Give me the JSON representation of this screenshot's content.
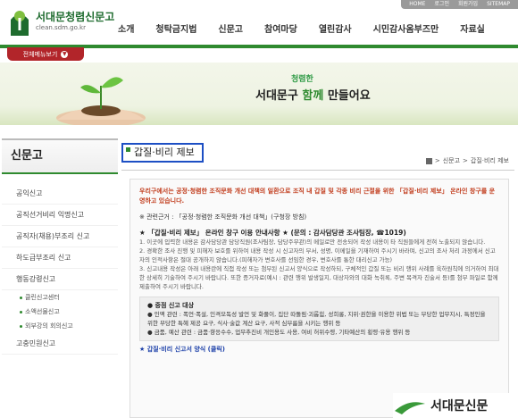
{
  "util_links": [
    "HOME",
    "로그인",
    "회원가입",
    "SITEMAP"
  ],
  "logo": {
    "title": "서대문청렴신문고",
    "subtitle": "clean.sdm.go.kr"
  },
  "gnb": [
    "소개",
    "청탁금지법",
    "신문고",
    "참여마당",
    "열린감사",
    "시민감사옴부즈만",
    "자료실"
  ],
  "all_menu_label": "전체메뉴보기",
  "banner": {
    "small": "청렴한",
    "slogan_prefix": "서대문구 ",
    "slogan_highlight": "함께",
    "slogan_suffix": " 만들어요"
  },
  "sidebar": {
    "title": "신문고",
    "items": [
      {
        "label": "공익신고"
      },
      {
        "label": "공직선거비리 익명신고"
      },
      {
        "label": "공직자(채용)부조리 신고"
      },
      {
        "label": "하도급부조리 신고"
      },
      {
        "label": "행동강령신고"
      }
    ],
    "subitems": [
      {
        "label": "클린신고센터"
      },
      {
        "label": "소액선물신고"
      },
      {
        "label": "외부강의 회의신고"
      }
    ],
    "last_item": "고충민원신고"
  },
  "page_title": "갑질·비리 제보",
  "breadcrumb": [
    "신문고",
    "갑질·비리 제보"
  ],
  "content": {
    "intro": "우리구에서는 공정·청렴한 조직문화 개선 대책의 일환으로 조직 내 갑질 및 각종 비리 근절을 위한 「갑질·비리 제보」 온라인 창구를 운영하고 있습니다.",
    "basis": "※ 관련근거 : 「공정·청렴한 조직문화 개선 대책」(구청장 방침)",
    "guide_title": "★ 「갑질·비리 제보」 온라인 창구 이용 안내사항 ★ (문의 : 감사담당관 조사팀장, ☎1019)",
    "guide_items": [
      "1. 이곳에 입력한 내용은 감사담당관 담당직원(조사팀장, 담당주무관)의 메일로만 전송되어 작성 내용이 타 직원들에게 전혀 노출되지 않습니다.",
      "2. 경확한 조사 진행 및 피해자 보호를 위하여 내용 작성 시 신고자의 부서, 성명, 이메일을 기재하여 주시기 바라며, 신고의 조사 처리 과정에서 신고자의 인적사항은 절대 공개하지 않습니다.(피해자가 변호사를 선임한 경우, 변호사를 통한 대리신고 가능)",
      "3. 신고내용 작성은 아래 내용란에 직접 작성 또는 첨부된 신고서 양식으로 작성하되, 구체적인 갑질 또는 비리 행위 사례를 육하원칙에 의거하여 최대한 상세히 기술하여 주시기 바랍니다. 또한 증거자료(예시 : 관련 행위 발생일지, 대상자와의 대화 녹취록, 주변 목격자 진술서 등)를 첨부 파일로 함께 제출하여 주시기 바랍니다."
    ],
    "subject_title": "● 중점 신고 대상",
    "subject_lines": [
      "● 인맥 관련 : 폭언·폭설, 인격모독성 발언 및 화풀이, 집단 따돌림·괴롭힘, 성희롱, 지위·권한을 이용한 위법 또는 부당한 업무지시, 특정인을 위한 부당한 특혜 제공 요구, 식사·술값 계산 요구, 사적 심부름을 시키는 행위 등",
      "● 금품, 예산 관련 : 금품·향응수수, 업무추진비 개인용도 사용, 여비 허위수령, 기타예산의 횡령·유용 행위 등"
    ],
    "report_link": "★ 갑질·비리 신고서 양식 (클릭)"
  },
  "footer_name": "서대문신문",
  "colors": {
    "accent_green": "#2f8a2f",
    "accent_red": "#b2252a",
    "title_border": "#1d4fc4"
  }
}
